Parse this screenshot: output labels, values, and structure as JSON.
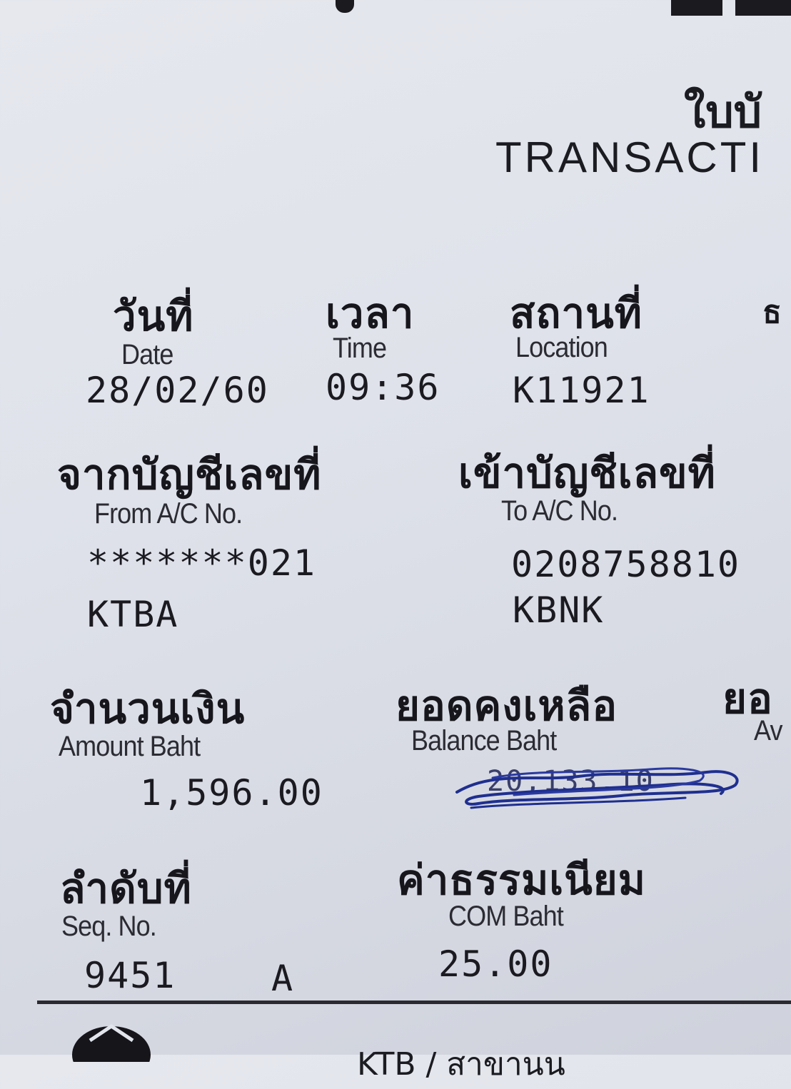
{
  "header": {
    "title_thai": "ใบบั",
    "title_en": "TRANSACTI"
  },
  "date": {
    "label_th": "วันที่",
    "label_en": "Date",
    "value": "28/02/60"
  },
  "time": {
    "label_th": "เวลา",
    "label_en": "Time",
    "value": "09:36"
  },
  "location": {
    "label_th": "สถานที่",
    "label_en": "Location",
    "value": "K11921"
  },
  "edge_char": "ธ",
  "from_account": {
    "label_th": "จากบัญชีเลขที่",
    "label_en": "From A/C No.",
    "number": "*******021",
    "bank": "KTBA"
  },
  "to_account": {
    "label_th": "เข้าบัญชีเลขที่",
    "label_en": "To A/C No.",
    "number": "0208758810",
    "bank": "KBNK"
  },
  "amount": {
    "label_th": "จำนวนเงิน",
    "label_en": "Amount Baht",
    "value": "1,596.00"
  },
  "balance": {
    "label_th": "ยอดคงเหลือ",
    "label_en": "Balance Baht",
    "value": "20,133.10"
  },
  "available": {
    "label_th": "ยอ",
    "label_en": "Av"
  },
  "sequence": {
    "label_th": "ลำดับที่",
    "label_en": "Seq. No.",
    "value": "9451",
    "suffix": "A"
  },
  "commission": {
    "label_th": "ค่าธรรมเนียม",
    "label_en": "COM Baht",
    "value": "25.00"
  },
  "footer": {
    "text": "KTB / สาขานน"
  },
  "colors": {
    "paper": "#e2e5ec",
    "ink": "#1b1b22",
    "pen": "#1f2f8f"
  }
}
